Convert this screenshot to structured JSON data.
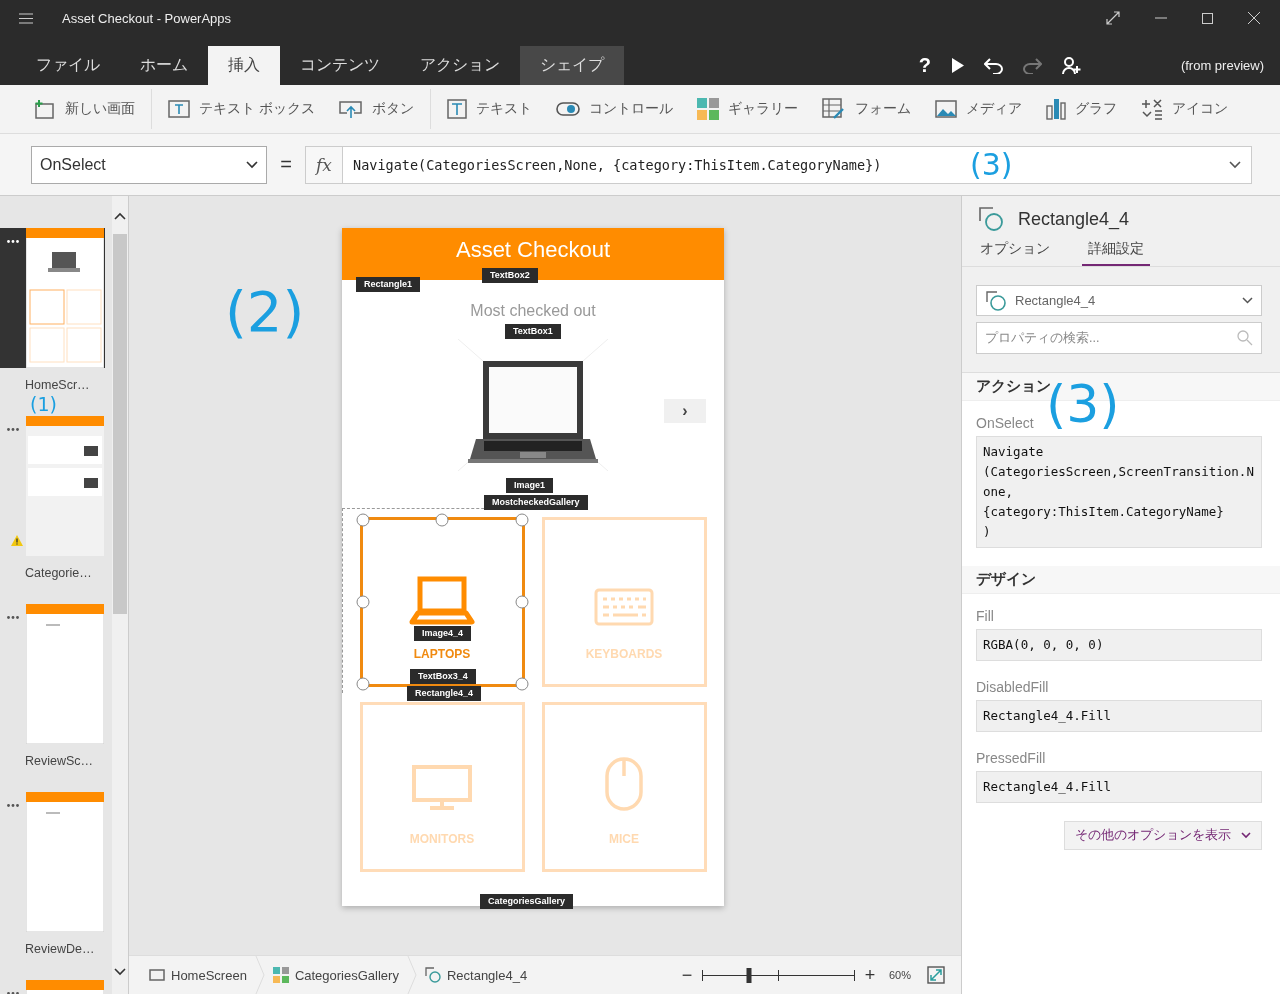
{
  "window": {
    "title": "Asset Checkout - PowerApps"
  },
  "tabs": [
    {
      "label": "ファイル",
      "selected": false,
      "kind": "normal"
    },
    {
      "label": "ホーム",
      "selected": false,
      "kind": "normal"
    },
    {
      "label": "挿入",
      "selected": true,
      "kind": "normal"
    },
    {
      "label": "コンテンツ",
      "selected": false,
      "kind": "normal"
    },
    {
      "label": "アクション",
      "selected": false,
      "kind": "normal"
    },
    {
      "label": "シェイプ",
      "selected": false,
      "kind": "contextual"
    }
  ],
  "quick_actions": [
    {
      "kind": "help",
      "label": "?",
      "disabled": false
    },
    {
      "kind": "play",
      "disabled": false
    },
    {
      "kind": "undo",
      "disabled": false
    },
    {
      "kind": "redo",
      "disabled": true
    },
    {
      "kind": "user",
      "disabled": false
    }
  ],
  "account": "(from preview)",
  "ribbon": [
    {
      "kind": "new-screen",
      "label": "新しい画面",
      "group_end": true
    },
    {
      "kind": "text-box",
      "label": "テキスト ボックス",
      "group_end": false
    },
    {
      "kind": "button",
      "label": "ボタン",
      "group_end": true
    },
    {
      "kind": "text",
      "label": "テキスト",
      "group_end": false
    },
    {
      "kind": "control",
      "label": "コントロール",
      "group_end": false
    },
    {
      "kind": "gallery",
      "label": "ギャラリー",
      "group_end": false
    },
    {
      "kind": "form",
      "label": "フォーム",
      "group_end": false
    },
    {
      "kind": "media",
      "label": "メディア",
      "group_end": false
    },
    {
      "kind": "chart",
      "label": "グラフ",
      "group_end": false
    },
    {
      "kind": "icon",
      "label": "アイコン",
      "group_end": false
    }
  ],
  "formula_bar": {
    "property": "OnSelect",
    "equals": "=",
    "fx": "fx",
    "formula": "Navigate(CategoriesScreen,None, {category:ThisItem.CategoryName})",
    "annotation": "(3)"
  },
  "screens_panel": {
    "annotation": "(1)",
    "screens": [
      {
        "name": "HomeScr…",
        "selected": true,
        "warning": false,
        "kind": "home"
      },
      {
        "name": "Categorie…",
        "selected": false,
        "warning": true,
        "kind": "list"
      },
      {
        "name": "ReviewSc…",
        "selected": false,
        "warning": false,
        "kind": "review"
      },
      {
        "name": "ReviewDe…",
        "selected": false,
        "warning": false,
        "kind": "review"
      },
      {
        "selected": false,
        "kind": "review"
      }
    ]
  },
  "canvas": {
    "annotation": "(2)",
    "app": {
      "title": "Asset Checkout",
      "subtitle": "Most checked out",
      "next_label": "›",
      "categories": [
        {
          "label": "LAPTOPS",
          "kind": "laptop",
          "selected": true
        },
        {
          "label": "KEYBOARDS",
          "kind": "keyboard",
          "selected": false
        },
        {
          "label": "MONITORS",
          "kind": "monitor",
          "selected": false
        },
        {
          "label": "MICE",
          "kind": "mouse",
          "selected": false
        }
      ],
      "control_tags": [
        {
          "label": "TextBox2"
        },
        {
          "label": "Rectangle1"
        },
        {
          "label": "TextBox1"
        },
        {
          "label": "Image1"
        },
        {
          "label": "MostcheckedGallery"
        },
        {
          "label": "Image4_4"
        },
        {
          "label": "TextBox3_4"
        },
        {
          "label": "Rectangle4_4"
        },
        {
          "label": "CategoriesGallery"
        }
      ]
    }
  },
  "breadcrumbs": [
    {
      "kind": "screen",
      "label": "HomeScreen"
    },
    {
      "kind": "gallery",
      "label": "CategoriesGallery"
    },
    {
      "kind": "shape",
      "label": "Rectangle4_4"
    }
  ],
  "zoom": {
    "minus": "−",
    "plus": "+",
    "level": 0.31,
    "reading": "60%"
  },
  "properties": {
    "title": "Rectangle4_4",
    "tabs": [
      {
        "label": "オプション",
        "selected": false
      },
      {
        "label": "詳細設定",
        "selected": true
      }
    ],
    "control_select": "Rectangle4_4",
    "search_placeholder": "プロパティの検索...",
    "annotation": "(3)",
    "sections": [
      {
        "title": "アクション",
        "properties": [
          {
            "name": "OnSelect",
            "value": "Navigate\n(CategoriesScreen,ScreenTransition.None,\n{category:ThisItem.CategoryName}\n)"
          }
        ]
      },
      {
        "title": "デザイン",
        "properties": [
          {
            "name": "Fill",
            "value": "RGBA(0, 0, 0, 0)"
          },
          {
            "name": "DisabledFill",
            "value": "Rectangle4_4.Fill"
          },
          {
            "name": "PressedFill",
            "value": "Rectangle4_4.Fill"
          }
        ]
      }
    ],
    "more_button": "その他のオプションを表示"
  }
}
